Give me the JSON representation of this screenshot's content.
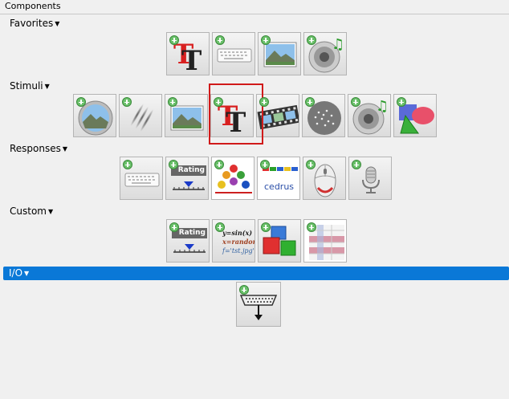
{
  "panel": {
    "title": "Components"
  },
  "categories": {
    "favorites": {
      "label": "Favorites"
    },
    "stimuli": {
      "label": "Stimuli"
    },
    "responses": {
      "label": "Responses"
    },
    "custom": {
      "label": "Custom"
    },
    "io": {
      "label": "I/O"
    }
  },
  "components": {
    "rating_text": "Rating",
    "code_lines": [
      "y=sin(x)",
      "x=random(,",
      "f='tst.jpg'"
    ],
    "cedrus_text": "cedrus"
  },
  "colors": {
    "selected_row": "#0a78d7",
    "highlight": "#d01a1a"
  },
  "selected_component": "text-component"
}
